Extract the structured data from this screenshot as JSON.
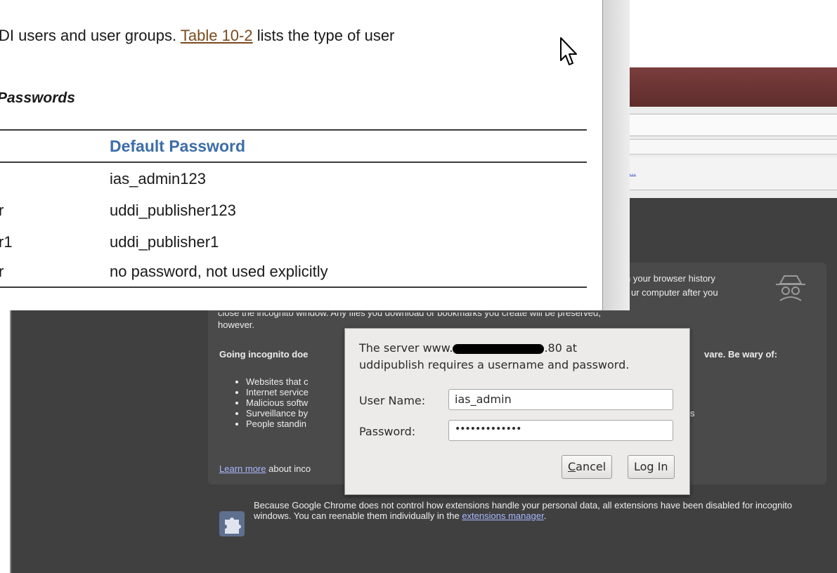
{
  "background_browser": {
    "bookmark_link": "...",
    "incognito_lines": [
      "n your browser history",
      "ur computer after you",
      "close the incognito window. Any files you download or bookmarks you create will be preserved,",
      "however."
    ],
    "going_incognito": "Going incognito doe",
    "beware": "vare. Be wary of:",
    "bullets": [
      "Websites that c",
      "Internet service",
      "Malicious softw",
      "Surveillance by",
      "People standin"
    ],
    "bullet_tail": "s",
    "learn_more_link": "Learn more",
    "learn_more_rest": "about inco",
    "extensions_text": "Because Google Chrome does not control how extensions handle your personal data, all extensions have been disabled for incognito windows. You can reenable them individually in the",
    "extensions_link": "extensions manager",
    "extensions_period": ".",
    "spy_icon": "incognito-spy-icon",
    "extension_icon": "puzzle-piece-icon"
  },
  "doc": {
    "line1_prefix": "DI users and user groups.",
    "line1_link": "Table 10-2",
    "line1_suffix": "lists the type of user",
    "heading": "Passwords",
    "column_header": "Default Password",
    "rows": [
      {
        "left": "",
        "password": "ias_admin123"
      },
      {
        "left": "r",
        "password": "uddi_publisher123"
      },
      {
        "left": "r1",
        "password": "uddi_publisher1"
      },
      {
        "left": "r",
        "password": "no password, not used explicitly"
      }
    ],
    "cursor_icon": "mouse-pointer-icon"
  },
  "auth_dialog": {
    "message_prefix": "The server www.",
    "message_host_suffix": ".80 at",
    "message_line2": "uddipublish requires a username and password.",
    "username_label": "User Name:",
    "username_value": "ias_admin",
    "password_label": "Password:",
    "password_value": "•••••••••••••",
    "cancel_label": "Cancel",
    "login_label": "Log In"
  }
}
